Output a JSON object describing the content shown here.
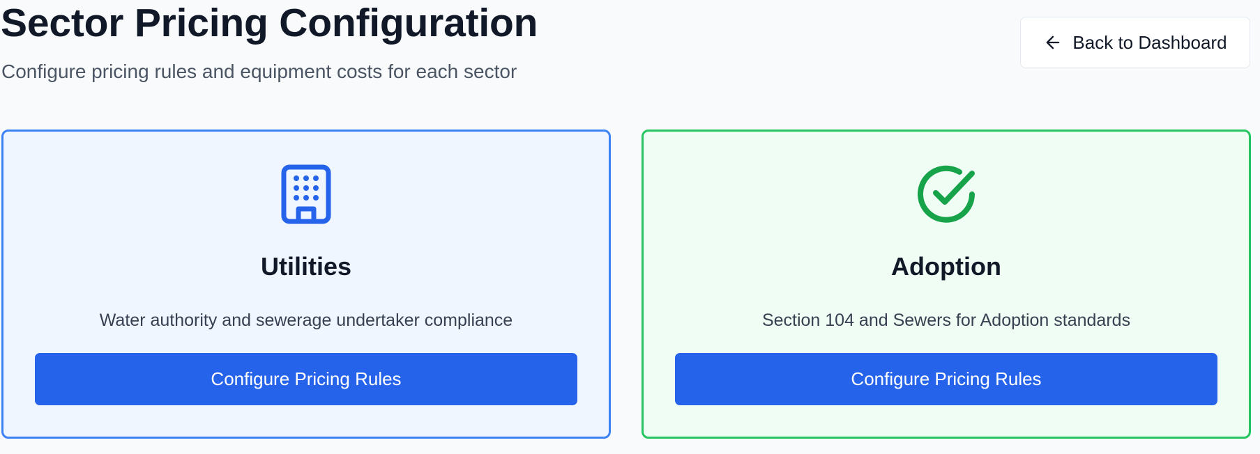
{
  "header": {
    "title": "Sector Pricing Configuration",
    "subtitle": "Configure pricing rules and equipment costs for each sector",
    "back_button_label": "Back to Dashboard",
    "back_icon": "arrow-left-icon"
  },
  "sectors": [
    {
      "icon": "building-icon",
      "title": "Utilities",
      "description": "Water authority and sewerage undertaker compliance",
      "button_label": "Configure Pricing Rules",
      "accent_color": "#3b82f6",
      "background_color": "#eff6ff",
      "icon_color": "#2563eb"
    },
    {
      "icon": "check-circle-icon",
      "title": "Adoption",
      "description": "Section 104 and Sewers for Adoption standards",
      "button_label": "Configure Pricing Rules",
      "accent_color": "#22c55e",
      "background_color": "#f0fdf4",
      "icon_color": "#16a34a"
    }
  ],
  "colors": {
    "primary_button": "#2563eb",
    "page_background": "#f8fafc",
    "text_dark": "#111827",
    "text_muted": "#4b5563"
  }
}
